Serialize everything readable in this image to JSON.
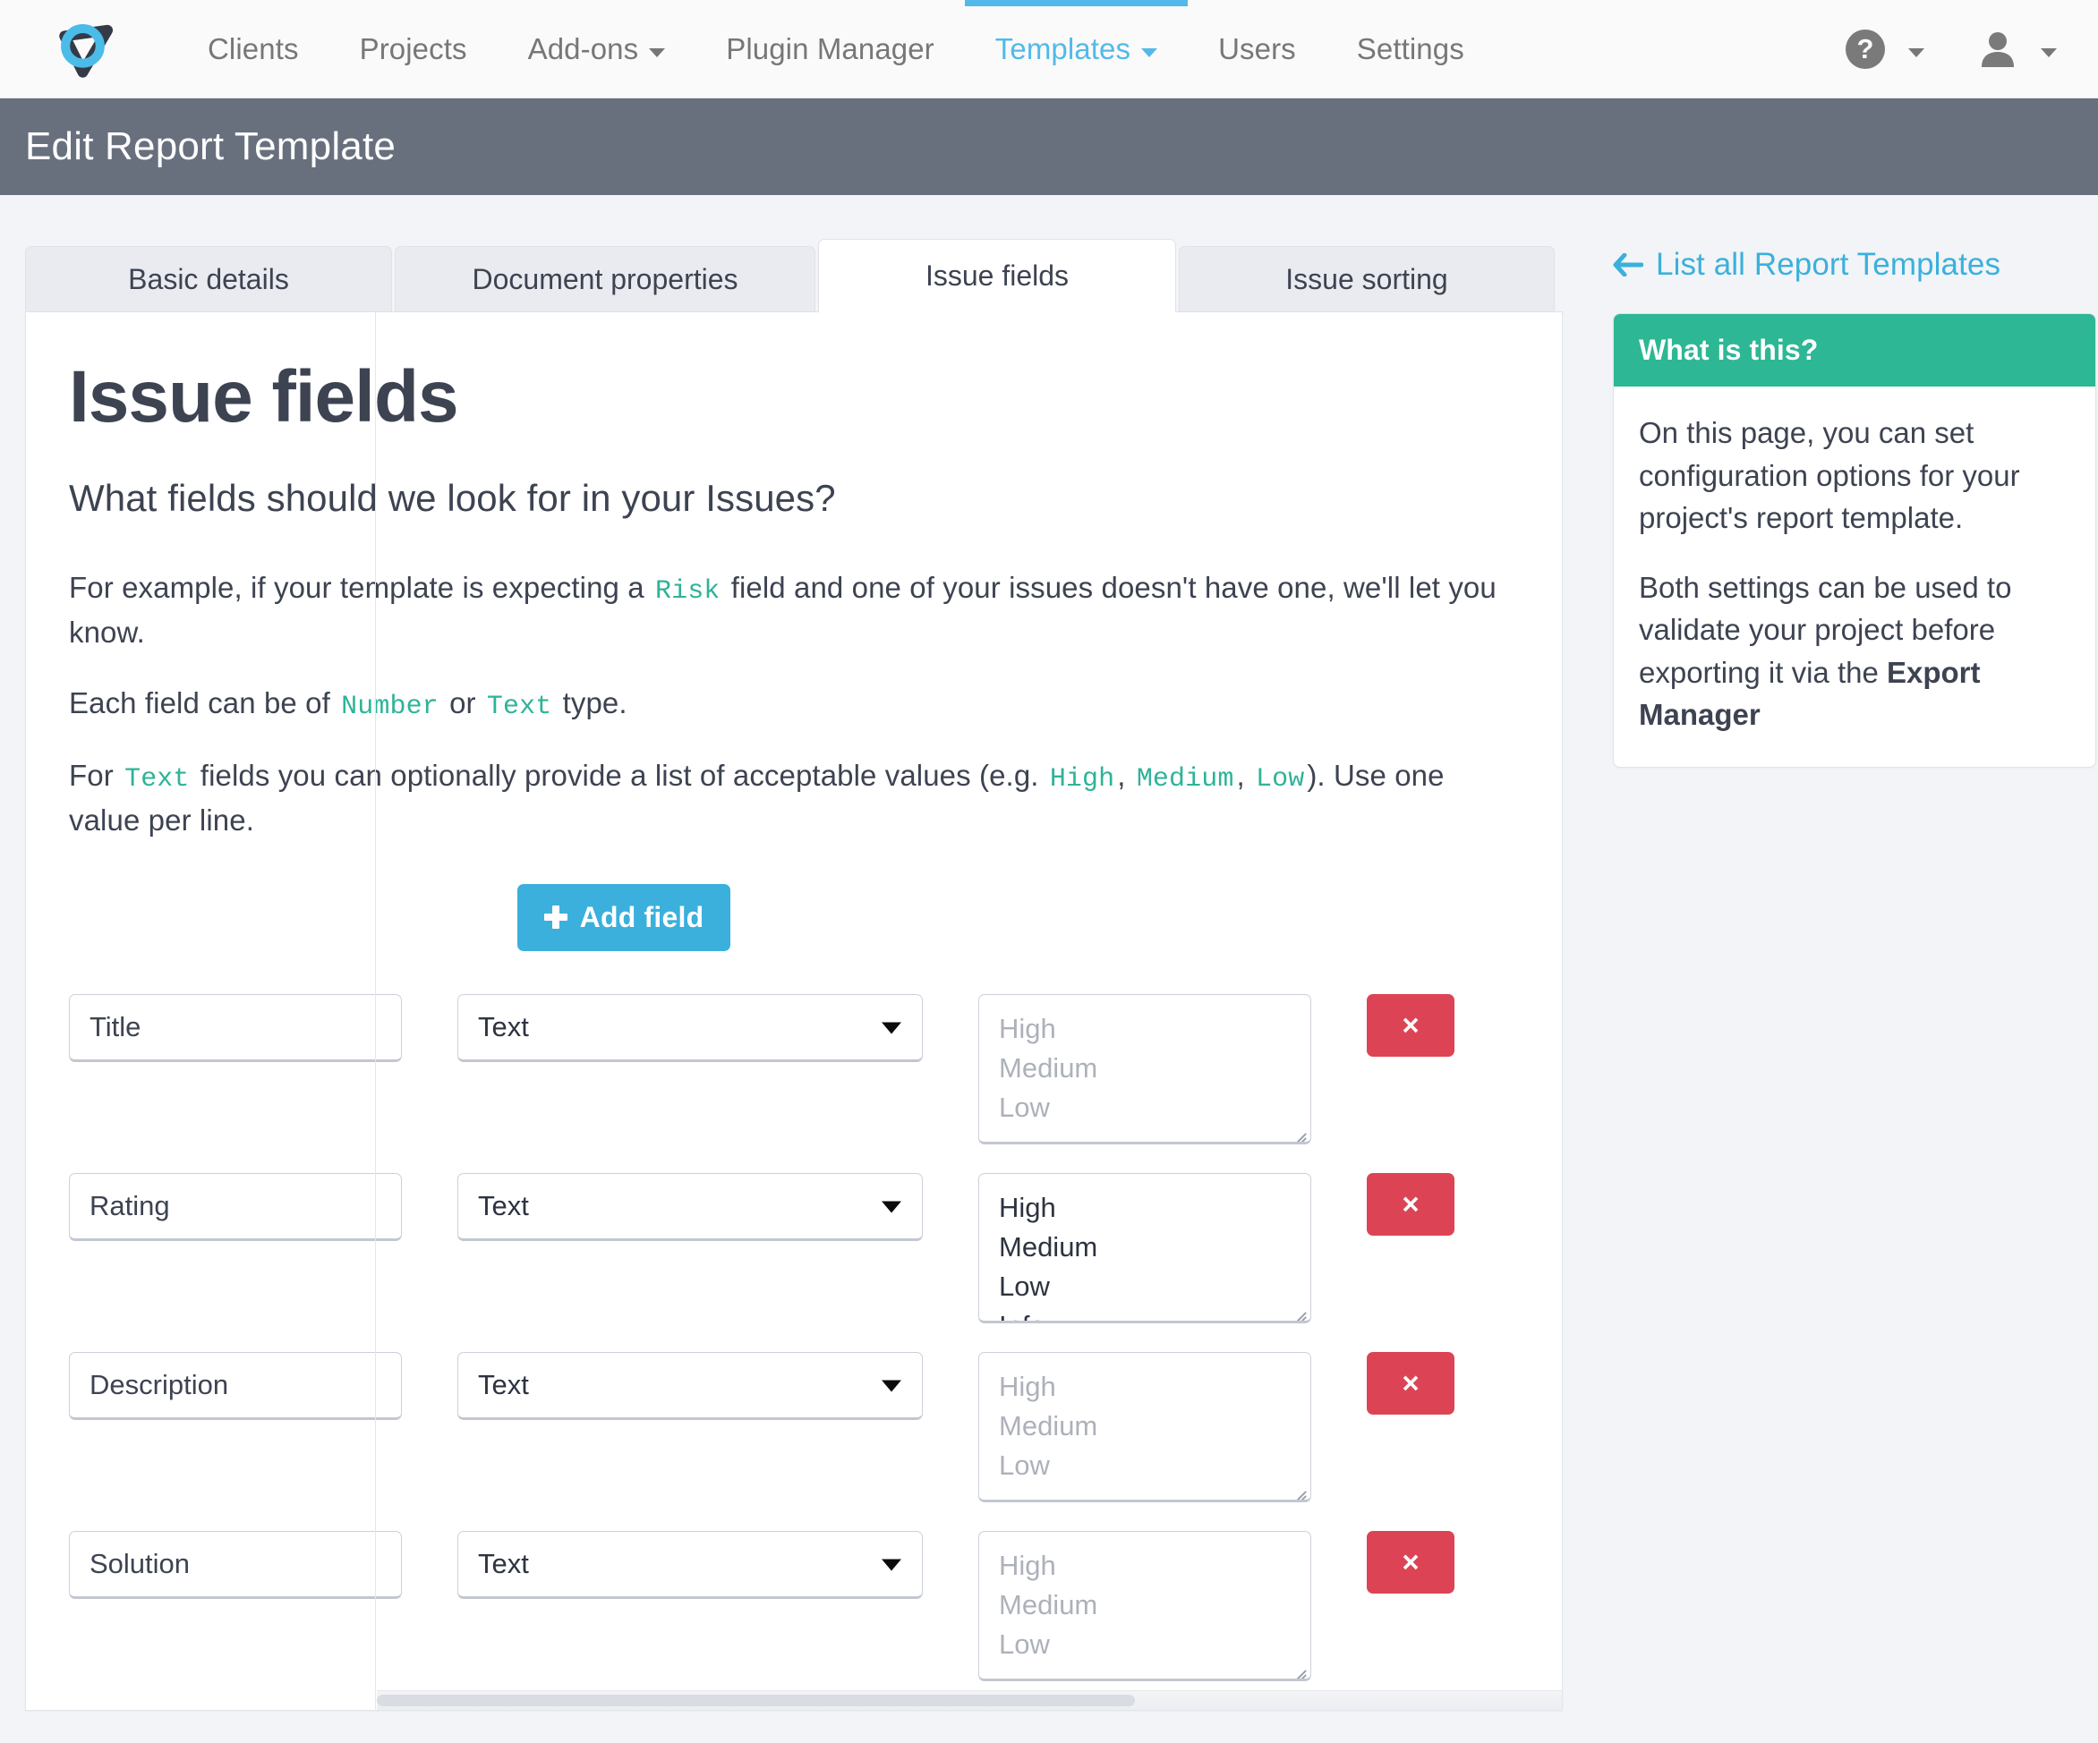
{
  "navbar": {
    "logo_name": "logo",
    "items": [
      {
        "label": "Clients",
        "active": false,
        "dropdown": false
      },
      {
        "label": "Projects",
        "active": false,
        "dropdown": false
      },
      {
        "label": "Add-ons",
        "active": false,
        "dropdown": true
      },
      {
        "label": "Plugin Manager",
        "active": false,
        "dropdown": false
      },
      {
        "label": "Templates",
        "active": true,
        "dropdown": true
      },
      {
        "label": "Users",
        "active": false,
        "dropdown": false
      },
      {
        "label": "Settings",
        "active": false,
        "dropdown": false
      }
    ],
    "help_glyph": "?",
    "accent_color": "#53b9e8"
  },
  "page_header": {
    "title": "Edit Report Template",
    "background_color": "#68707e"
  },
  "tabs": [
    {
      "label": "Basic details",
      "active": false
    },
    {
      "label": "Document properties",
      "active": false
    },
    {
      "label": "Issue fields",
      "active": true
    },
    {
      "label": "Issue sorting",
      "active": false
    }
  ],
  "main": {
    "heading": "Issue fields",
    "subheading": "What fields should we look for in your Issues?",
    "para1_a": "For example, if your template is expecting a",
    "para1_code": "Risk",
    "para1_b": "field and one of your issues doesn't have one, we'll let you know.",
    "para2_a": "Each field can be of",
    "para2_code1": "Number",
    "para2_b": "or",
    "para2_code2": "Text",
    "para2_c": "type.",
    "para3_a": "For",
    "para3_code1": "Text",
    "para3_b": "fields you can optionally provide a list of acceptable values (e.g.",
    "para3_code2": "High",
    "para3_comma1": ",",
    "para3_code3": "Medium",
    "para3_comma2": ",",
    "para3_code4": "Low",
    "para3_c": "). Use one value per line.",
    "add_field_label": "Add field",
    "add_field_color": "#3bb0dd",
    "delete_label": "×",
    "delete_color": "#dc4455"
  },
  "fields": [
    {
      "name": "Title",
      "type": "Text",
      "values_are_placeholder": true,
      "values": [
        "High",
        "Medium",
        "Low"
      ]
    },
    {
      "name": "Rating",
      "type": "Text",
      "values_are_placeholder": false,
      "values": [
        "High",
        "Medium",
        "Low",
        "Info"
      ]
    },
    {
      "name": "Description",
      "type": "Text",
      "values_are_placeholder": true,
      "values": [
        "High",
        "Medium",
        "Low"
      ]
    },
    {
      "name": "Solution",
      "type": "Text",
      "values_are_placeholder": true,
      "values": [
        "High",
        "Medium",
        "Low"
      ]
    }
  ],
  "sidebar": {
    "back_link": "List all Report Templates",
    "panel_title": "What is this?",
    "panel_color": "#2eb795",
    "panel_p1": "On this page, you can set configuration options for your project's report template.",
    "panel_p2_a": "Both settings can be used to validate your project before exporting it via the ",
    "panel_p2_strong": "Export Manager"
  }
}
